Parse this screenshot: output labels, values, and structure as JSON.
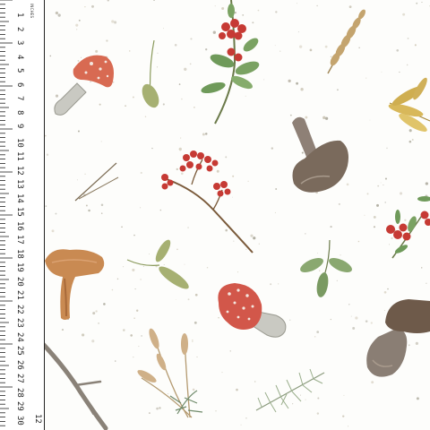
{
  "ruler": {
    "units": "INCHES",
    "labels": [
      "1",
      "2",
      "3",
      "4",
      "5",
      "6",
      "7",
      "8",
      "9",
      "10",
      "11",
      "12",
      "13",
      "14",
      "15",
      "16",
      "17",
      "18",
      "19",
      "20",
      "21",
      "22",
      "23",
      "24",
      "25",
      "26",
      "27",
      "28",
      "29",
      "30"
    ],
    "bottom_label": "12"
  },
  "motifs": [
    {
      "id": "fly-agaric-mushroom-top"
    },
    {
      "id": "cowberry-sprig"
    },
    {
      "id": "wheat-ear"
    },
    {
      "id": "golden-leaves"
    },
    {
      "id": "single-green-leaf"
    },
    {
      "id": "brown-mushroom-top"
    },
    {
      "id": "pine-needles"
    },
    {
      "id": "red-berry-branch"
    },
    {
      "id": "cowberry-sprig-right"
    },
    {
      "id": "chanterelle-mushroom"
    },
    {
      "id": "green-leaf-sprig"
    },
    {
      "id": "fly-agaric-mushroom-bottom"
    },
    {
      "id": "green-leaves-right"
    },
    {
      "id": "porcini-mushroom"
    },
    {
      "id": "twig"
    },
    {
      "id": "dry-grass-bouquet"
    },
    {
      "id": "fir-branch"
    }
  ]
}
